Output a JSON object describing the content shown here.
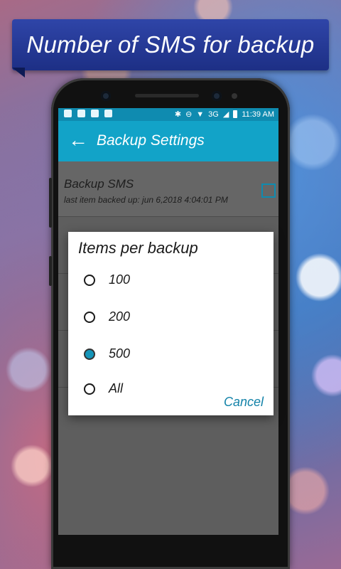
{
  "banner": {
    "title": "Number of SMS for backup"
  },
  "status_bar": {
    "network": "3G",
    "time": "11:39",
    "ampm": "AM"
  },
  "app_bar": {
    "title": "Backup Settings",
    "back_icon": "arrow-left-icon"
  },
  "settings": [
    {
      "title": "Backup SMS",
      "subtitle": "last item backed up: jun 6,2018 4:04:01 PM",
      "checked": false
    }
  ],
  "dialog": {
    "title": "Items per backup",
    "options": [
      {
        "label": "100",
        "selected": false
      },
      {
        "label": "200",
        "selected": false
      },
      {
        "label": "500",
        "selected": true
      },
      {
        "label": "All",
        "selected": false
      }
    ],
    "cancel_label": "Cancel"
  },
  "colors": {
    "accent": "#12a3c8",
    "status_bar": "#0f8bb0",
    "banner": "#2a3f9e"
  }
}
